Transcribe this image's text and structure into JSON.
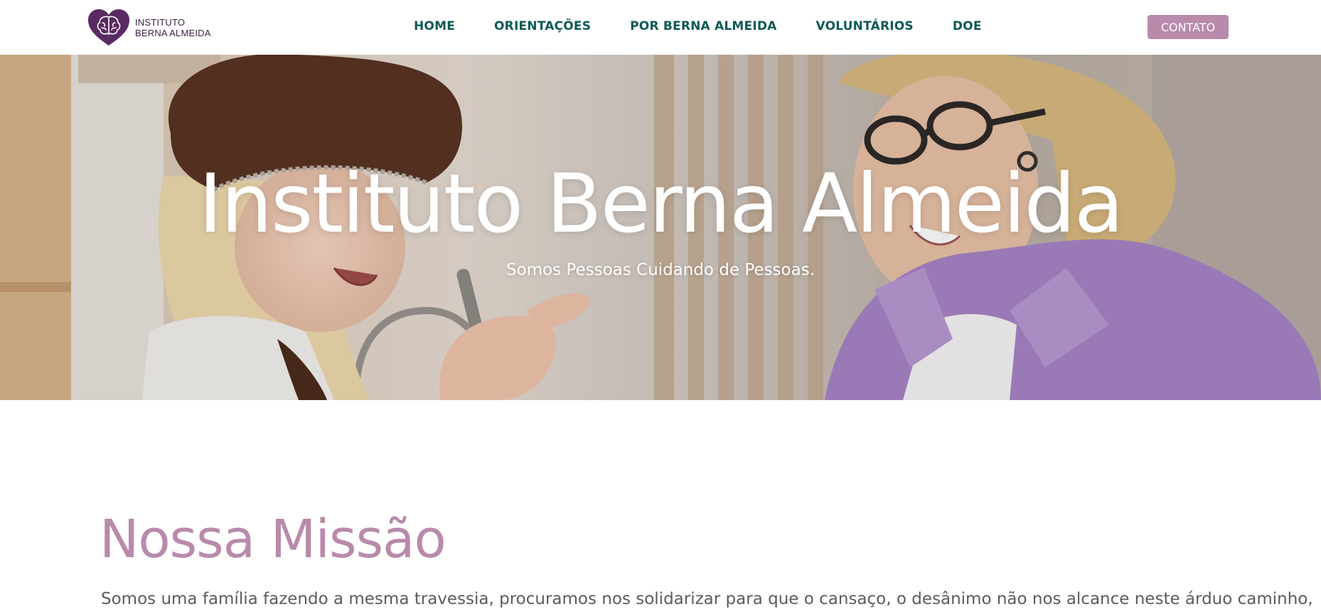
{
  "header": {
    "logo": {
      "line1": "INSTITUTO",
      "line2": "BERNA ALMEIDA",
      "icon": "brain-heart-icon"
    },
    "nav": [
      {
        "label": "HOME"
      },
      {
        "label": "ORIENTAÇÕES"
      },
      {
        "label": "POR BERNA ALMEIDA"
      },
      {
        "label": "VOLUNTÁRIOS"
      },
      {
        "label": "DOE"
      }
    ],
    "contact_label": "CONTATO"
  },
  "hero": {
    "title": "Instituto Berna Almeida",
    "subtitle": "Somos Pessoas Cuidando de Pessoas.",
    "image": "photo of a child in a chef hat cooking with a woman in a purple shirt"
  },
  "mission": {
    "title": "Nossa Missão",
    "text": "Somos uma família fazendo a mesma travessia, procuramos nos solidarizar para que o cansaço, o desânimo não nos alcance neste árduo caminho,"
  },
  "colors": {
    "nav_text": "#0f5a55",
    "accent_pink": "#b98aab",
    "logo_purple": "#5a2a62",
    "body_text": "#5c5c5c"
  }
}
